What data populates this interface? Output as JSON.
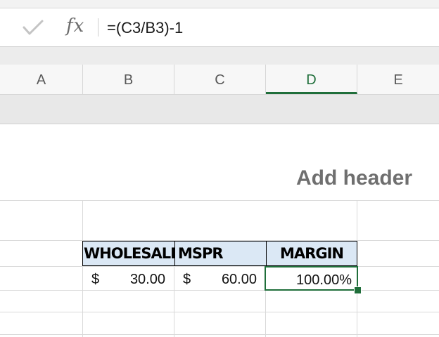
{
  "formula_bar": {
    "check_icon": "check-icon",
    "fx_label": "fx",
    "formula": "=(C3/B3)-1"
  },
  "columns": [
    {
      "label": "A",
      "selected": false
    },
    {
      "label": "B",
      "selected": false
    },
    {
      "label": "C",
      "selected": false
    },
    {
      "label": "D",
      "selected": true
    },
    {
      "label": "E",
      "selected": false
    }
  ],
  "page_header": {
    "placeholder": "Add header"
  },
  "table": {
    "headers": {
      "b": "WHOLESALE",
      "c": "MSPR",
      "d": "MARGIN"
    },
    "row3": {
      "b_currency": "$",
      "b_value": "30.00",
      "c_currency": "$",
      "c_value": "60.00",
      "d_value": "100.00%"
    }
  },
  "colors": {
    "selection": "#1f6e3a",
    "header_fill": "#dbe8f5"
  }
}
